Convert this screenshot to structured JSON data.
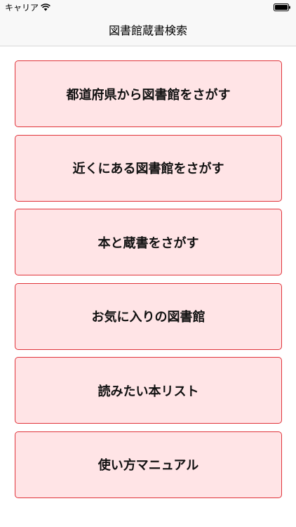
{
  "status_bar": {
    "carrier": "キャリア",
    "wifi_icon": "wifi-icon",
    "battery_icon": "battery-full-icon"
  },
  "nav": {
    "title": "図書館蔵書検索"
  },
  "menu": {
    "items": [
      {
        "label": "都道府県から図書館をさがす"
      },
      {
        "label": "近くにある図書館をさがす"
      },
      {
        "label": "本と蔵書をさがす"
      },
      {
        "label": "お気に入りの図書館"
      },
      {
        "label": "読みたい本リスト"
      },
      {
        "label": "使い方マニュアル"
      }
    ]
  },
  "colors": {
    "button_bg": "#ffe4e6",
    "button_border": "#e0333a",
    "bar_bg": "#f8f8f8"
  }
}
